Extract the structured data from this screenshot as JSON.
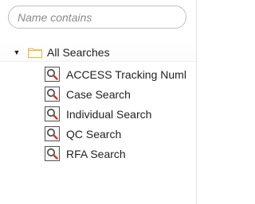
{
  "search": {
    "placeholder": "Name contains",
    "value": ""
  },
  "tree": {
    "root": {
      "label": "All Searches",
      "expanded": true,
      "icon": "folder-icon"
    },
    "items": [
      {
        "label": "ACCESS Tracking Numl",
        "icon": "search-icon"
      },
      {
        "label": "Case Search",
        "icon": "search-icon"
      },
      {
        "label": "Individual Search",
        "icon": "search-icon"
      },
      {
        "label": "QC Search",
        "icon": "search-icon"
      },
      {
        "label": "RFA Search",
        "icon": "search-icon"
      }
    ]
  },
  "colors": {
    "folder": "#f1b23e",
    "icon_border": "#555555",
    "input_border": "#bfbfbf"
  }
}
